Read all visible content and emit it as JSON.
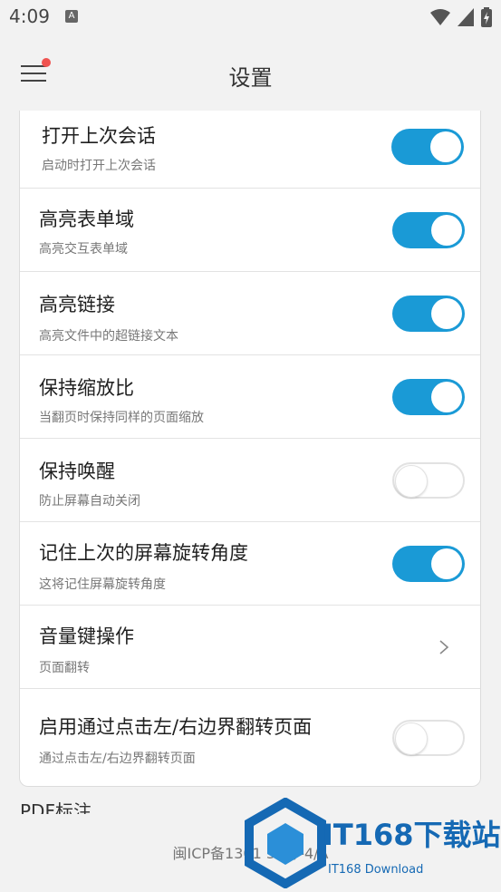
{
  "status_bar": {
    "time": "4:09",
    "notification_icon": "A"
  },
  "app_bar": {
    "title": "设置",
    "has_badge": true
  },
  "settings": [
    {
      "title": "打开上次会话",
      "subtitle": "启动时打开上次会话",
      "control": "toggle",
      "enabled": true
    },
    {
      "title": "高亮表单域",
      "subtitle": "高亮交互表单域",
      "control": "toggle",
      "enabled": true
    },
    {
      "title": "高亮链接",
      "subtitle": "高亮文件中的超链接文本",
      "control": "toggle",
      "enabled": true
    },
    {
      "title": "保持缩放比",
      "subtitle": "当翻页时保持同样的页面缩放",
      "control": "toggle",
      "enabled": true
    },
    {
      "title": "保持唤醒",
      "subtitle": "防止屏幕自动关闭",
      "control": "toggle",
      "enabled": false
    },
    {
      "title": "记住上次的屏幕旋转角度",
      "subtitle": "这将记住屏幕旋转角度",
      "control": "toggle",
      "enabled": true
    },
    {
      "title": "音量键操作",
      "subtitle": "页面翻转",
      "control": "chevron"
    },
    {
      "title": "启用通过点击左/右边界翻转页面",
      "subtitle": "通过点击左/右边界翻转页面",
      "control": "toggle",
      "enabled": false
    }
  ],
  "next_section_partial": "PDF标注",
  "icp_text": "闽ICP备1301   34号-4/A",
  "watermark": {
    "brand": "IT168下载站",
    "sub": "IT168 Download"
  },
  "colors": {
    "accent": "#1a9ad6",
    "badge": "#ef5350",
    "watermark": "#1569b4"
  }
}
